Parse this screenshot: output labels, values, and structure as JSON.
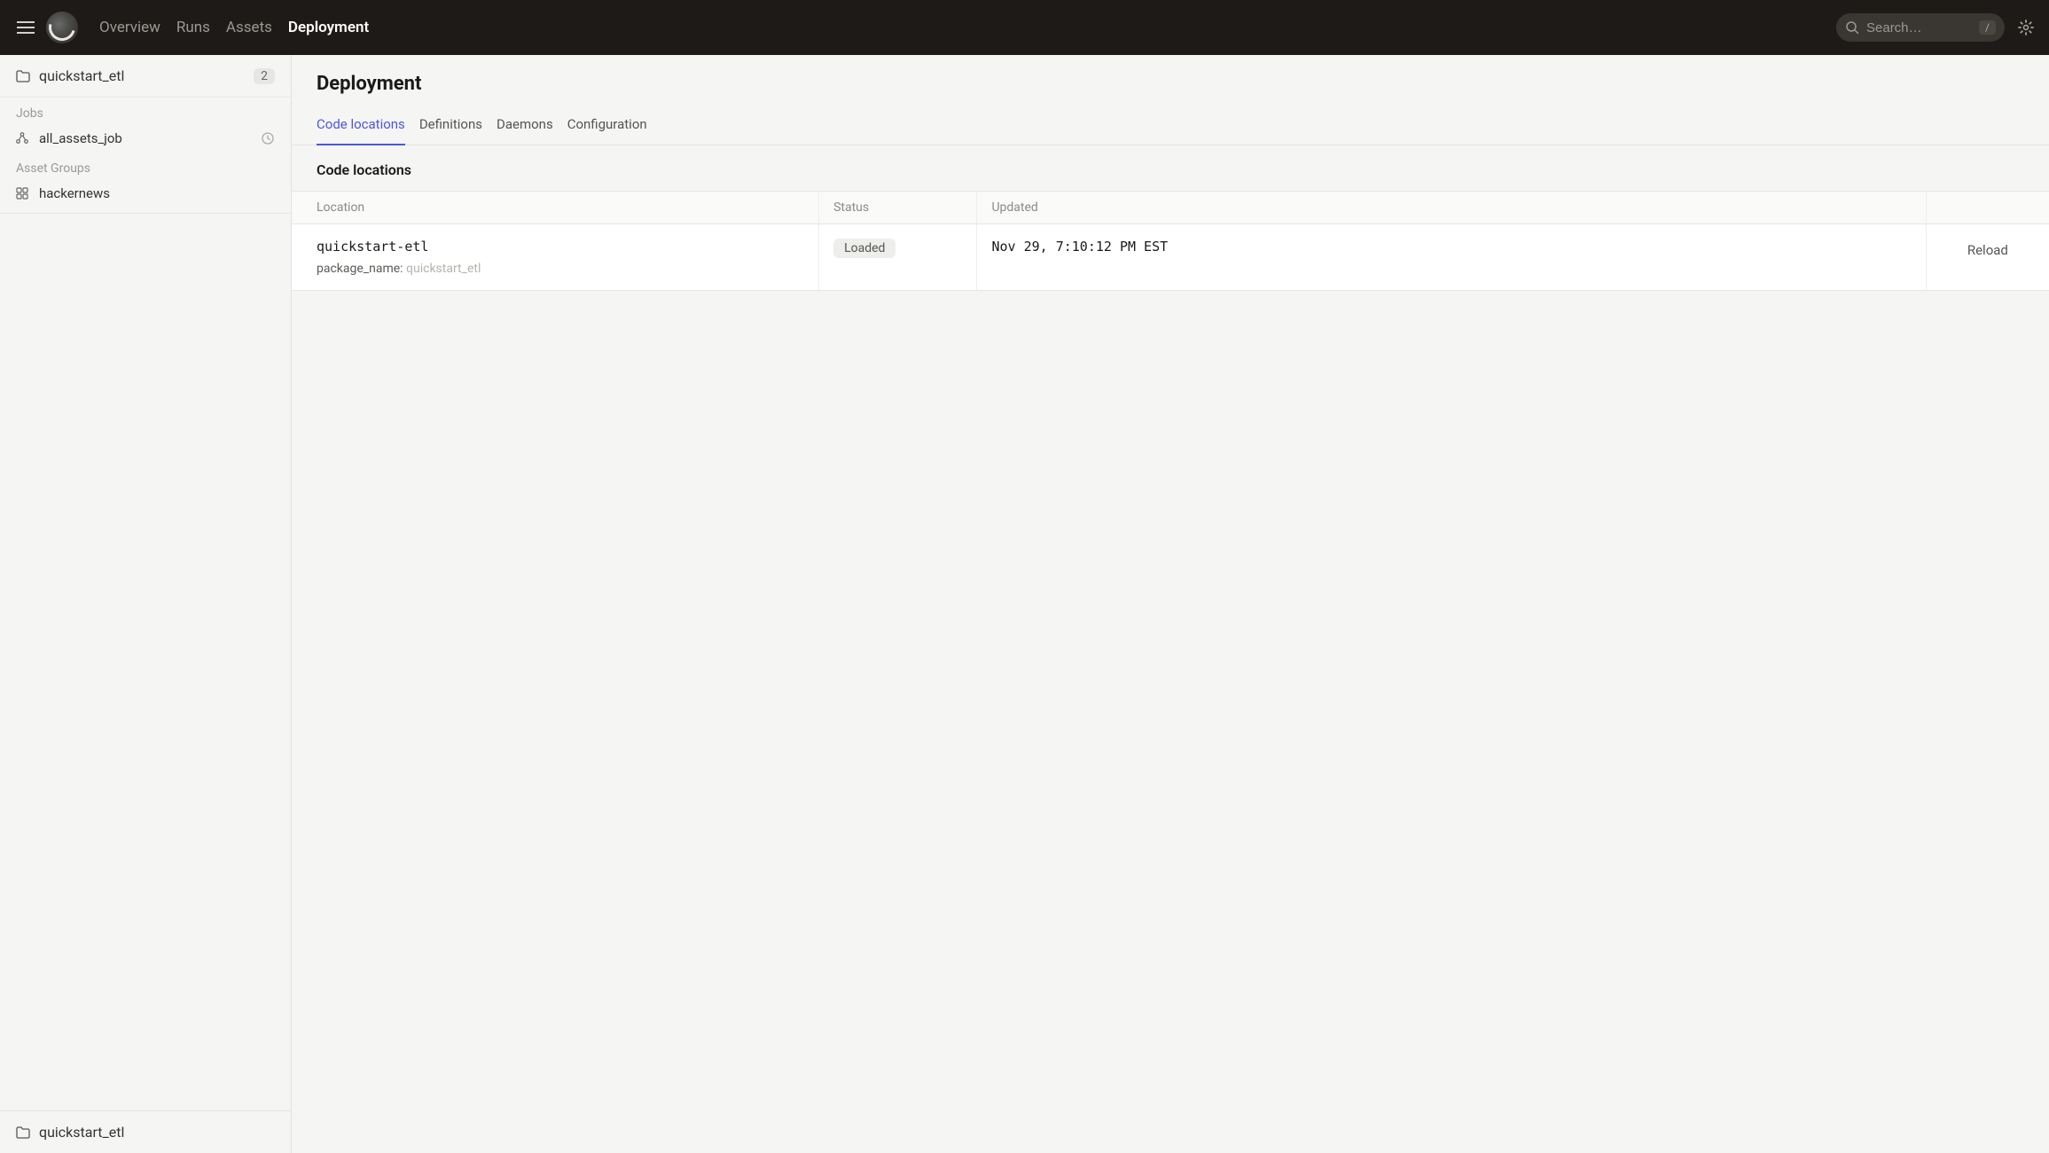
{
  "nav": {
    "items": [
      {
        "label": "Overview",
        "active": false
      },
      {
        "label": "Runs",
        "active": false
      },
      {
        "label": "Assets",
        "active": false
      },
      {
        "label": "Deployment",
        "active": true
      }
    ]
  },
  "search": {
    "placeholder": "Search…",
    "shortcut": "/"
  },
  "sidebar": {
    "repo": {
      "name": "quickstart_etl",
      "count": "2"
    },
    "sections": {
      "jobs": {
        "label": "Jobs",
        "items": [
          {
            "label": "all_assets_job"
          }
        ]
      },
      "asset_groups": {
        "label": "Asset Groups",
        "items": [
          {
            "label": "hackernews"
          }
        ]
      }
    },
    "footer": {
      "label": "quickstart_etl"
    }
  },
  "page": {
    "title": "Deployment",
    "tabs": [
      {
        "label": "Code locations",
        "active": true
      },
      {
        "label": "Definitions",
        "active": false
      },
      {
        "label": "Daemons",
        "active": false
      },
      {
        "label": "Configuration",
        "active": false
      }
    ],
    "section_title": "Code locations",
    "table": {
      "headers": {
        "location": "Location",
        "status": "Status",
        "updated": "Updated",
        "action": ""
      },
      "rows": [
        {
          "location_name": "quickstart-etl",
          "package_label": "package_name:",
          "package_value": "quickstart_etl",
          "status": "Loaded",
          "updated": "Nov 29, 7:10:12 PM EST",
          "action": "Reload"
        }
      ]
    }
  }
}
